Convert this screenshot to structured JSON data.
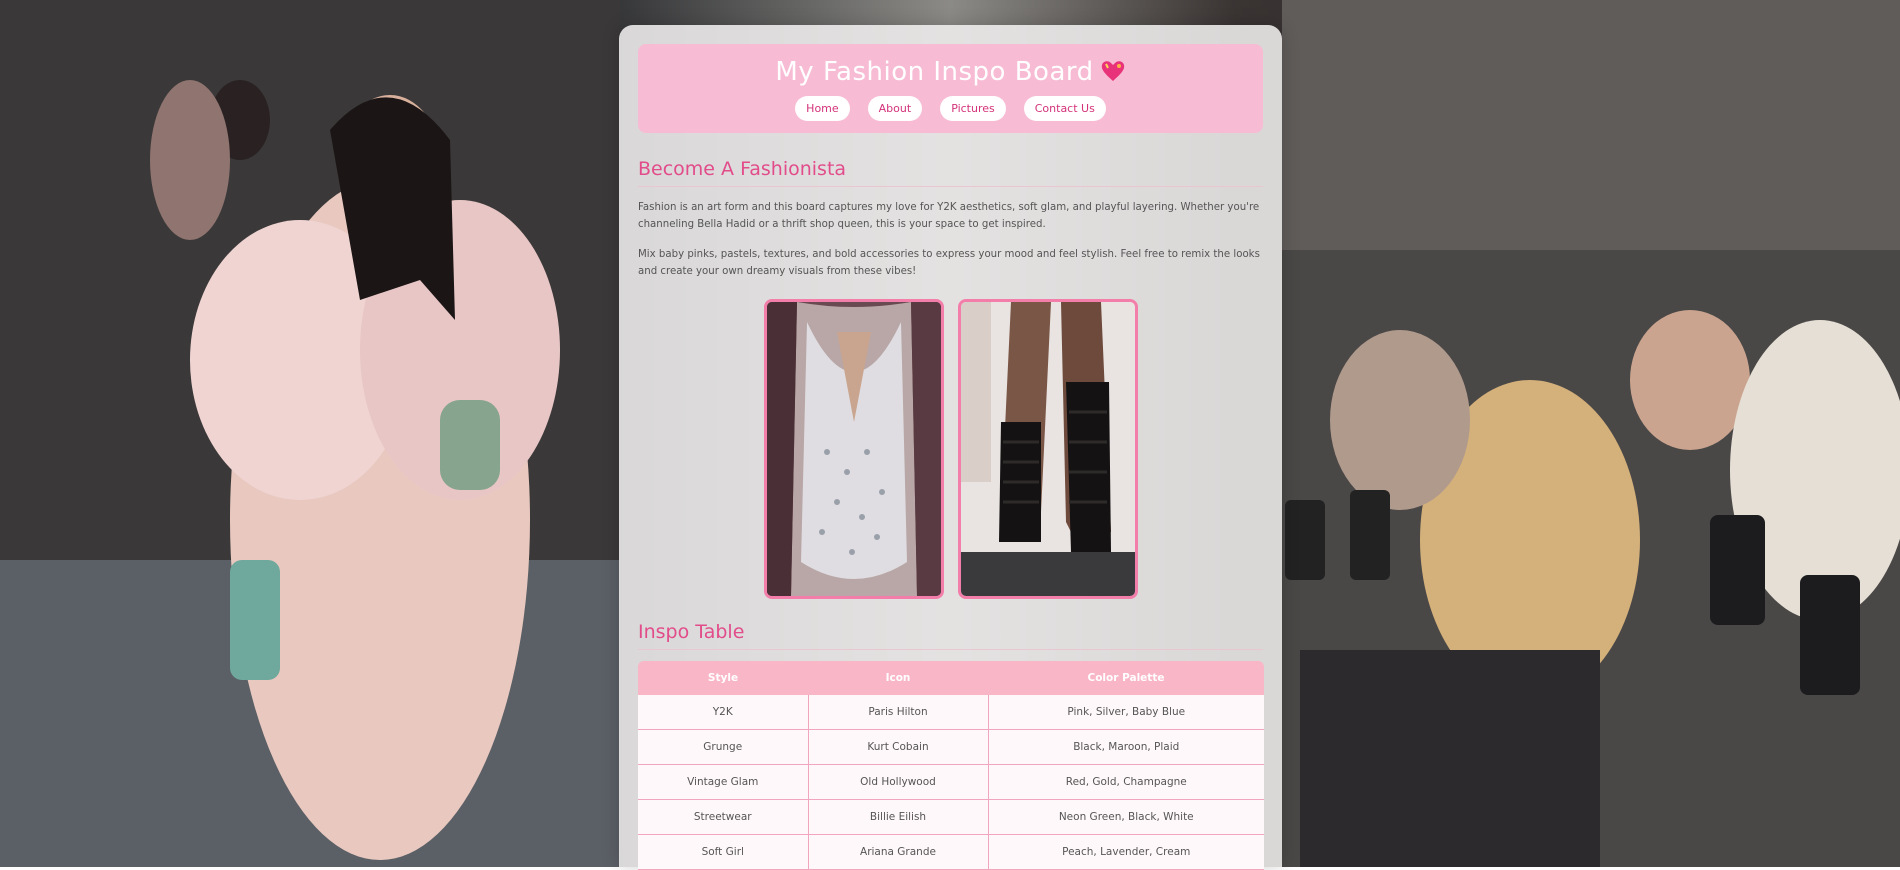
{
  "header": {
    "title": "My Fashion Inspo Board",
    "nav": [
      "Home",
      "About",
      "Pictures",
      "Contact Us"
    ]
  },
  "intro": {
    "heading": "Become A Fashionista",
    "paragraphs": [
      "Fashion is an art form and this board captures my love for Y2K aesthetics, soft glam, and playful layering. Whether you're channeling Bella Hadid or a thrift shop queen, this is your space to get inspired.",
      "Mix baby pinks, pastels, textures, and bold accessories to express your mood and feel stylish. Feel free to remix the looks and create your own dreamy visuals from these vibes!"
    ]
  },
  "table": {
    "heading": "Inspo Table",
    "columns": [
      "Style",
      "Icon",
      "Color Palette"
    ],
    "rows": [
      [
        "Y2K",
        "Paris Hilton",
        "Pink, Silver, Baby Blue"
      ],
      [
        "Grunge",
        "Kurt Cobain",
        "Black, Maroon, Plaid"
      ],
      [
        "Vintage Glam",
        "Old Hollywood",
        "Red, Gold, Champagne"
      ],
      [
        "Streetwear",
        "Billie Eilish",
        "Neon Green, Black, White"
      ],
      [
        "Soft Girl",
        "Ariana Grande",
        "Peach, Lavender, Cream"
      ]
    ]
  },
  "colors": {
    "accent": "#e24c8a",
    "header_bg": "#f7bcd4",
    "table_header_bg": "#f9b6c7"
  }
}
